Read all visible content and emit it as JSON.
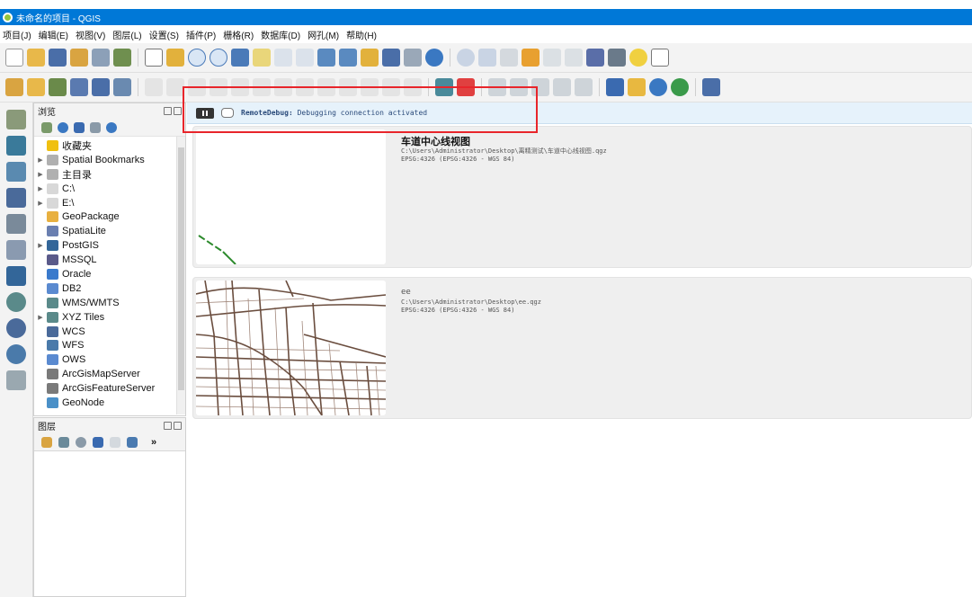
{
  "window": {
    "title": "未命名的项目 - QGIS"
  },
  "menubar": [
    "项目(J)",
    "编辑(E)",
    "视图(V)",
    "图层(L)",
    "设置(S)",
    "插件(P)",
    "栅格(R)",
    "数据库(D)",
    "网孔(M)",
    "帮助(H)"
  ],
  "browser": {
    "title": "浏览",
    "items": [
      {
        "label": "收藏夹",
        "icon": "star-icon",
        "expandable": false,
        "color": "#f0c010"
      },
      {
        "label": "Spatial Bookmarks",
        "icon": "bookmark-icon",
        "expandable": true,
        "color": "#b0b0b0"
      },
      {
        "label": "主目录",
        "icon": "home-icon",
        "expandable": true,
        "color": "#b0b0b0"
      },
      {
        "label": "C:\\",
        "icon": "folder-icon",
        "expandable": true,
        "color": "#d8d8d8"
      },
      {
        "label": "E:\\",
        "icon": "folder-icon",
        "expandable": true,
        "color": "#d8d8d8"
      },
      {
        "label": "GeoPackage",
        "icon": "geopackage-icon",
        "expandable": false,
        "color": "#e8b040"
      },
      {
        "label": "SpatiaLite",
        "icon": "feather-icon",
        "expandable": false,
        "color": "#6a7fb0"
      },
      {
        "label": "PostGIS",
        "icon": "elephant-icon",
        "expandable": true,
        "color": "#336699"
      },
      {
        "label": "MSSQL",
        "icon": "mssql-icon",
        "expandable": false,
        "color": "#5a5a8a"
      },
      {
        "label": "Oracle",
        "icon": "oracle-icon",
        "expandable": false,
        "color": "#3a7acc"
      },
      {
        "label": "DB2",
        "icon": "db2-icon",
        "expandable": false,
        "color": "#5a8ad0"
      },
      {
        "label": "WMS/WMTS",
        "icon": "globe-icon",
        "expandable": false,
        "color": "#5a8a8a"
      },
      {
        "label": "XYZ Tiles",
        "icon": "xyz-tiles-icon",
        "expandable": true,
        "color": "#5a8a8a"
      },
      {
        "label": "WCS",
        "icon": "wcs-icon",
        "expandable": false,
        "color": "#4a6a9a"
      },
      {
        "label": "WFS",
        "icon": "wfs-icon",
        "expandable": false,
        "color": "#4a7aaa"
      },
      {
        "label": "OWS",
        "icon": "ows-icon",
        "expandable": false,
        "color": "#5a8ad0"
      },
      {
        "label": "ArcGisMapServer",
        "icon": "arcgis-icon",
        "expandable": false,
        "color": "#7a7a7a"
      },
      {
        "label": "ArcGisFeatureServer",
        "icon": "arcgis-icon",
        "expandable": false,
        "color": "#7a7a7a"
      },
      {
        "label": "GeoNode",
        "icon": "geonode-icon",
        "expandable": false,
        "color": "#4a90c8"
      }
    ]
  },
  "layers": {
    "title": "图层"
  },
  "message": {
    "source": "RemoteDebug:",
    "text": " Debugging connection activated"
  },
  "recent_projects": [
    {
      "title": "车道中心线视图",
      "path": "C:\\Users\\Administrator\\Desktop\\离精测试\\车道中心线视图.qgz",
      "crs": "EPSG:4326 (EPSG:4326 - WGS 84)"
    },
    {
      "title": "ee",
      "path": "C:\\Users\\Administrator\\Desktop\\ee.qgz",
      "crs": "EPSG:4326 (EPSG:4326 - WGS 84)"
    }
  ],
  "colors": {
    "titlebar": "#0078d7",
    "highlight_box": "#e8252b",
    "message_bg": "#e6f2fb"
  }
}
